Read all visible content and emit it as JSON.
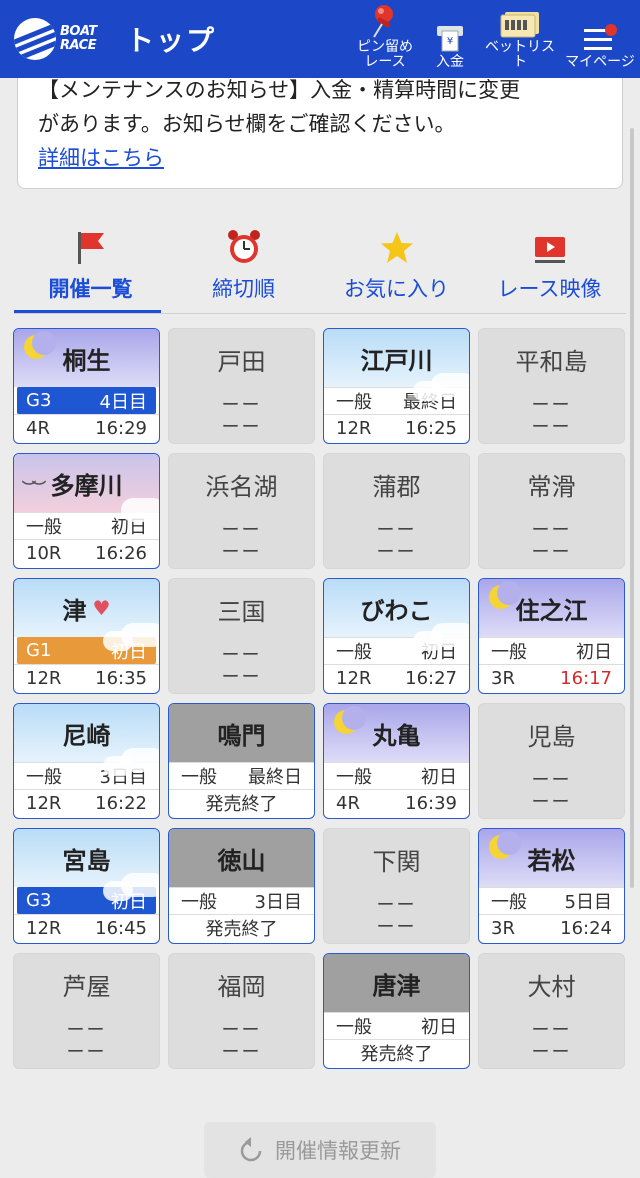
{
  "header": {
    "logo_text_1": "BOAT",
    "logo_text_2": "RACE",
    "title": "トップ",
    "nav": [
      {
        "label": "ピン留め\nレース",
        "icon": "pin-icon"
      },
      {
        "label": "入金",
        "icon": "deposit-icon"
      },
      {
        "label": "ベットリスト",
        "icon": "bet-list-icon"
      },
      {
        "label": "マイページ",
        "icon": "menu-icon"
      }
    ],
    "brand_color": "#1c48c8"
  },
  "notice": {
    "line1": "【メンテナンスのお知らせ】入金・精算時間に変更",
    "line2": "があります。お知らせ欄をご確認ください。",
    "link": "詳細はこちら"
  },
  "tabs": [
    {
      "label": "開催一覧",
      "icon": "flag-icon",
      "active": true
    },
    {
      "label": "締切順",
      "icon": "alarm-clock-icon",
      "active": false
    },
    {
      "label": "お気に入り",
      "icon": "star-icon",
      "active": false
    },
    {
      "label": "レース映像",
      "icon": "video-icon",
      "active": false
    }
  ],
  "venues": [
    {
      "name": "桐生",
      "status": "open",
      "sky": "night",
      "grade": "G3",
      "day": "4日目",
      "race": "4R",
      "time": "16:29"
    },
    {
      "name": "戸田",
      "status": "none",
      "dash1": "ーー",
      "dash2": "ーー"
    },
    {
      "name": "江戸川",
      "status": "open",
      "sky": "day",
      "grade": "一般",
      "day": "最終日",
      "race": "12R",
      "time": "16:25"
    },
    {
      "name": "平和島",
      "status": "none",
      "dash1": "ーー",
      "dash2": "ーー"
    },
    {
      "name": "多摩川",
      "status": "open",
      "sky": "dusk",
      "grade": "一般",
      "day": "初日",
      "race": "10R",
      "time": "16:26"
    },
    {
      "name": "浜名湖",
      "status": "none",
      "dash1": "ーー",
      "dash2": "ーー"
    },
    {
      "name": "蒲郡",
      "status": "none",
      "dash1": "ーー",
      "dash2": "ーー"
    },
    {
      "name": "常滑",
      "status": "none",
      "dash1": "ーー",
      "dash2": "ーー"
    },
    {
      "name": "津",
      "status": "open",
      "sky": "day",
      "grade": "G1",
      "day": "初日",
      "race": "12R",
      "time": "16:35",
      "favorite": true
    },
    {
      "name": "三国",
      "status": "none",
      "dash1": "ーー",
      "dash2": "ーー"
    },
    {
      "name": "びわこ",
      "status": "open",
      "sky": "day",
      "grade": "一般",
      "day": "初日",
      "race": "12R",
      "time": "16:27"
    },
    {
      "name": "住之江",
      "status": "open",
      "sky": "night",
      "grade": "一般",
      "day": "初日",
      "race": "3R",
      "time": "16:17",
      "late": true
    },
    {
      "name": "尼崎",
      "status": "open",
      "sky": "day",
      "grade": "一般",
      "day": "3日目",
      "race": "12R",
      "time": "16:22"
    },
    {
      "name": "鳴門",
      "status": "done",
      "grade": "一般",
      "day": "最終日",
      "closed": "発売終了"
    },
    {
      "name": "丸亀",
      "status": "open",
      "sky": "night",
      "grade": "一般",
      "day": "初日",
      "race": "4R",
      "time": "16:39"
    },
    {
      "name": "児島",
      "status": "none",
      "dash1": "ーー",
      "dash2": "ーー"
    },
    {
      "name": "宮島",
      "status": "open",
      "sky": "day",
      "grade": "G3",
      "day": "初日",
      "race": "12R",
      "time": "16:45"
    },
    {
      "name": "徳山",
      "status": "done",
      "grade": "一般",
      "day": "3日目",
      "closed": "発売終了"
    },
    {
      "name": "下関",
      "status": "none",
      "dash1": "ーー",
      "dash2": "ーー"
    },
    {
      "name": "若松",
      "status": "open",
      "sky": "night",
      "grade": "一般",
      "day": "5日目",
      "race": "3R",
      "time": "16:24"
    },
    {
      "name": "芦屋",
      "status": "none",
      "dash1": "ーー",
      "dash2": "ーー"
    },
    {
      "name": "福岡",
      "status": "none",
      "dash1": "ーー",
      "dash2": "ーー"
    },
    {
      "name": "唐津",
      "status": "done",
      "grade": "一般",
      "day": "初日",
      "closed": "発売終了"
    },
    {
      "name": "大村",
      "status": "none",
      "dash1": "ーー",
      "dash2": "ーー"
    }
  ],
  "refresh_button": "開催情報更新"
}
